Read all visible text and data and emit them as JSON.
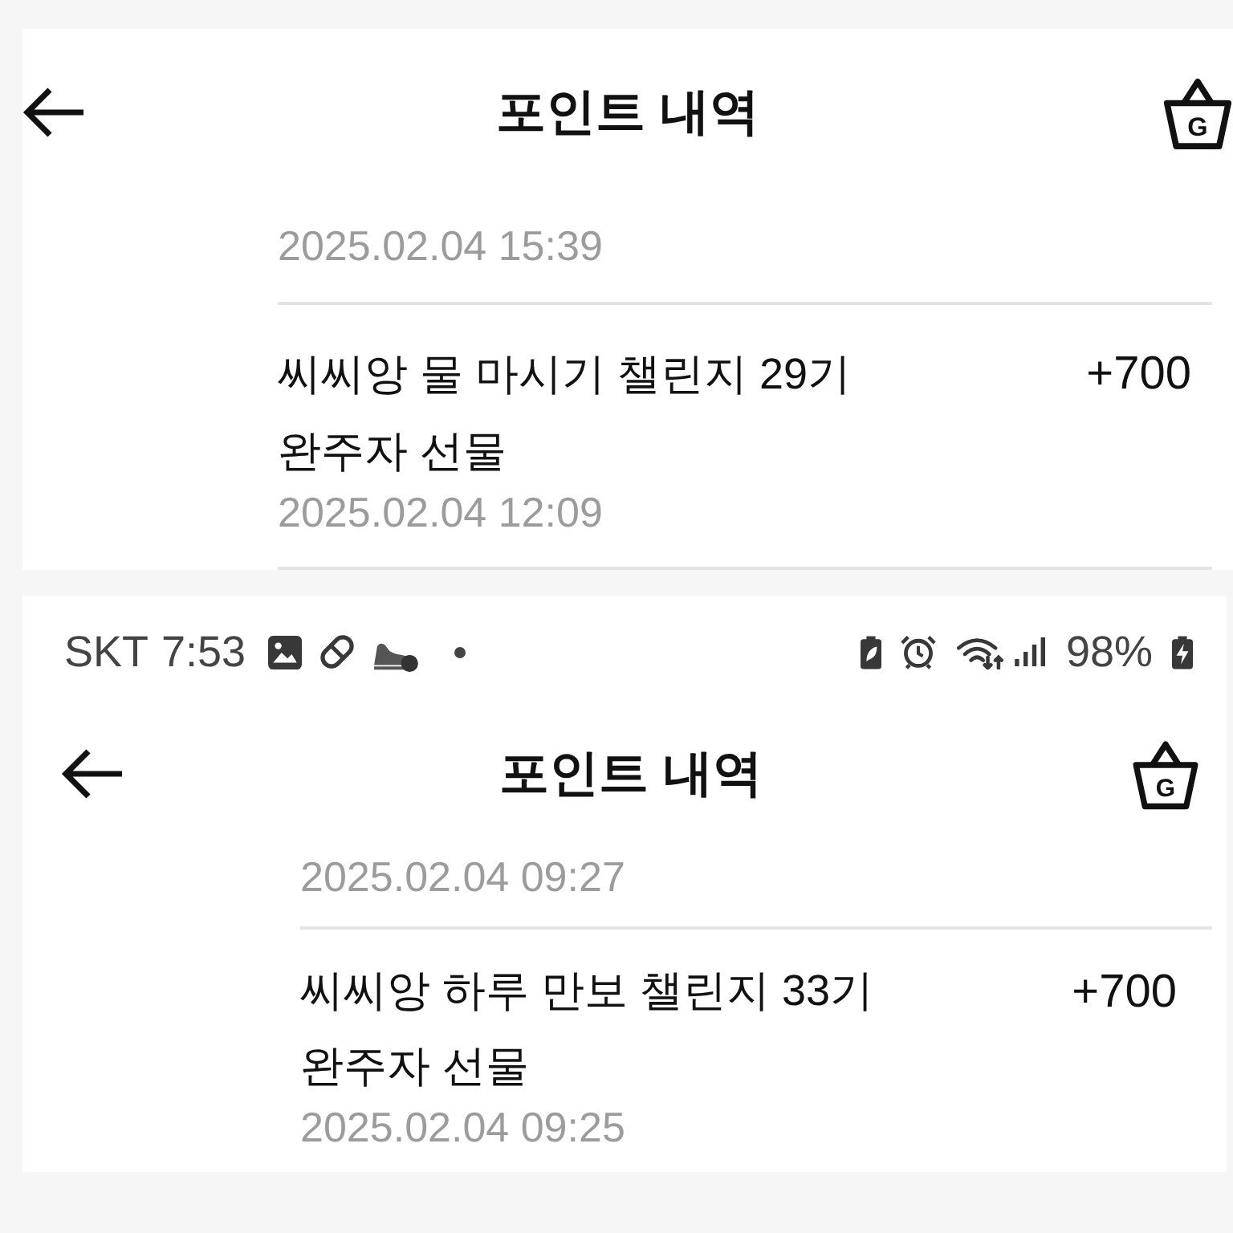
{
  "screenshots": [
    {
      "header": {
        "title": "포인트 내역",
        "basket_label": "G"
      },
      "entries": [
        {
          "date": "2025.02.04 15:39"
        },
        {
          "title": "씨씨앙 물 마시기 챌린지 29기 완주자 선물",
          "amount": "+700",
          "date": "2025.02.04 12:09"
        }
      ]
    },
    {
      "status_bar": {
        "carrier": "SKT",
        "time": "7:53",
        "battery": "98%"
      },
      "header": {
        "title": "포인트 내역",
        "basket_label": "G"
      },
      "entries": [
        {
          "date": "2025.02.04 09:27"
        },
        {
          "title": "씨씨앙 하루 만보 챌린지 33기 완주자 선물",
          "amount": "+700",
          "date": "2025.02.04 09:25"
        }
      ]
    }
  ]
}
